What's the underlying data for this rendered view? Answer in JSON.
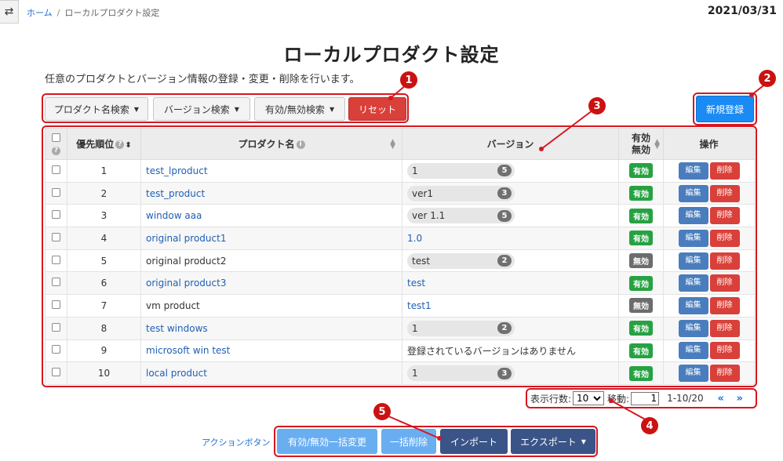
{
  "header": {
    "breadcrumb": {
      "home": "ホーム",
      "separator": "/",
      "current": "ローカルプロダクト設定"
    },
    "date": "2021/03/31",
    "toggle_icon": "swap-arrows-icon"
  },
  "page": {
    "title": "ローカルプロダクト設定",
    "subtitle": "任意のプロダクトとバージョン情報の登録・変更・削除を行います。"
  },
  "filters": {
    "product_search": "プロダクト名検索",
    "version_search": "バージョン検索",
    "status_search": "有効/無効検索",
    "reset": "リセット"
  },
  "new_register": "新規登録",
  "table": {
    "headers": {
      "priority": "優先順位",
      "product": "プロダクト名",
      "version": "バージョン",
      "status_line1": "有効",
      "status_line2": "無効",
      "ops": "操作"
    },
    "rows": [
      {
        "priority": "1",
        "product": "test_lproduct",
        "product_link": true,
        "version": "1",
        "version_count": "5",
        "status": "有効",
        "active": true
      },
      {
        "priority": "2",
        "product": "test_product",
        "product_link": true,
        "version": "ver1",
        "version_count": "3",
        "status": "有効",
        "active": true
      },
      {
        "priority": "3",
        "product": "window aaa",
        "product_link": true,
        "version": "ver 1.1",
        "version_count": "5",
        "status": "有効",
        "active": true
      },
      {
        "priority": "4",
        "product": "original product1",
        "product_link": true,
        "version": "1.0",
        "version_count": "",
        "status": "有効",
        "active": true
      },
      {
        "priority": "5",
        "product": "original product2",
        "product_link": false,
        "version": "test",
        "version_count": "2",
        "status": "無効",
        "active": false
      },
      {
        "priority": "6",
        "product": "original product3",
        "product_link": true,
        "version": "test",
        "version_count": "",
        "status": "有効",
        "active": true
      },
      {
        "priority": "7",
        "product": "vm product",
        "product_link": false,
        "version": "test1",
        "version_count": "",
        "status": "無効",
        "active": false
      },
      {
        "priority": "8",
        "product": "test windows",
        "product_link": true,
        "version": "1",
        "version_count": "2",
        "status": "有効",
        "active": true
      },
      {
        "priority": "9",
        "product": "microsoft win test",
        "product_link": true,
        "version": "登録されているバージョンはありません",
        "version_count": "",
        "status": "有効",
        "active": true
      },
      {
        "priority": "10",
        "product": "local product",
        "product_link": true,
        "version": "1",
        "version_count": "3",
        "status": "有効",
        "active": true
      }
    ],
    "edit_label": "編集",
    "delete_label": "削除"
  },
  "pagination": {
    "rows_label": "表示行数:",
    "rows_value": "10",
    "jump_label": "移動:",
    "jump_value": "1",
    "range": "1-10/20",
    "prev": "«",
    "next": "»"
  },
  "actions": {
    "label": "アクションボタン",
    "bulk_toggle": "有効/無効一括変更",
    "bulk_delete": "一括削除",
    "import": "インポート",
    "export": "エクスポート"
  },
  "markers": [
    "1",
    "2",
    "3",
    "4",
    "5"
  ],
  "colors": {
    "annotation_red": "#d8161f",
    "primary": "#1a8af4",
    "danger": "#d9403a",
    "success": "#27a243"
  }
}
